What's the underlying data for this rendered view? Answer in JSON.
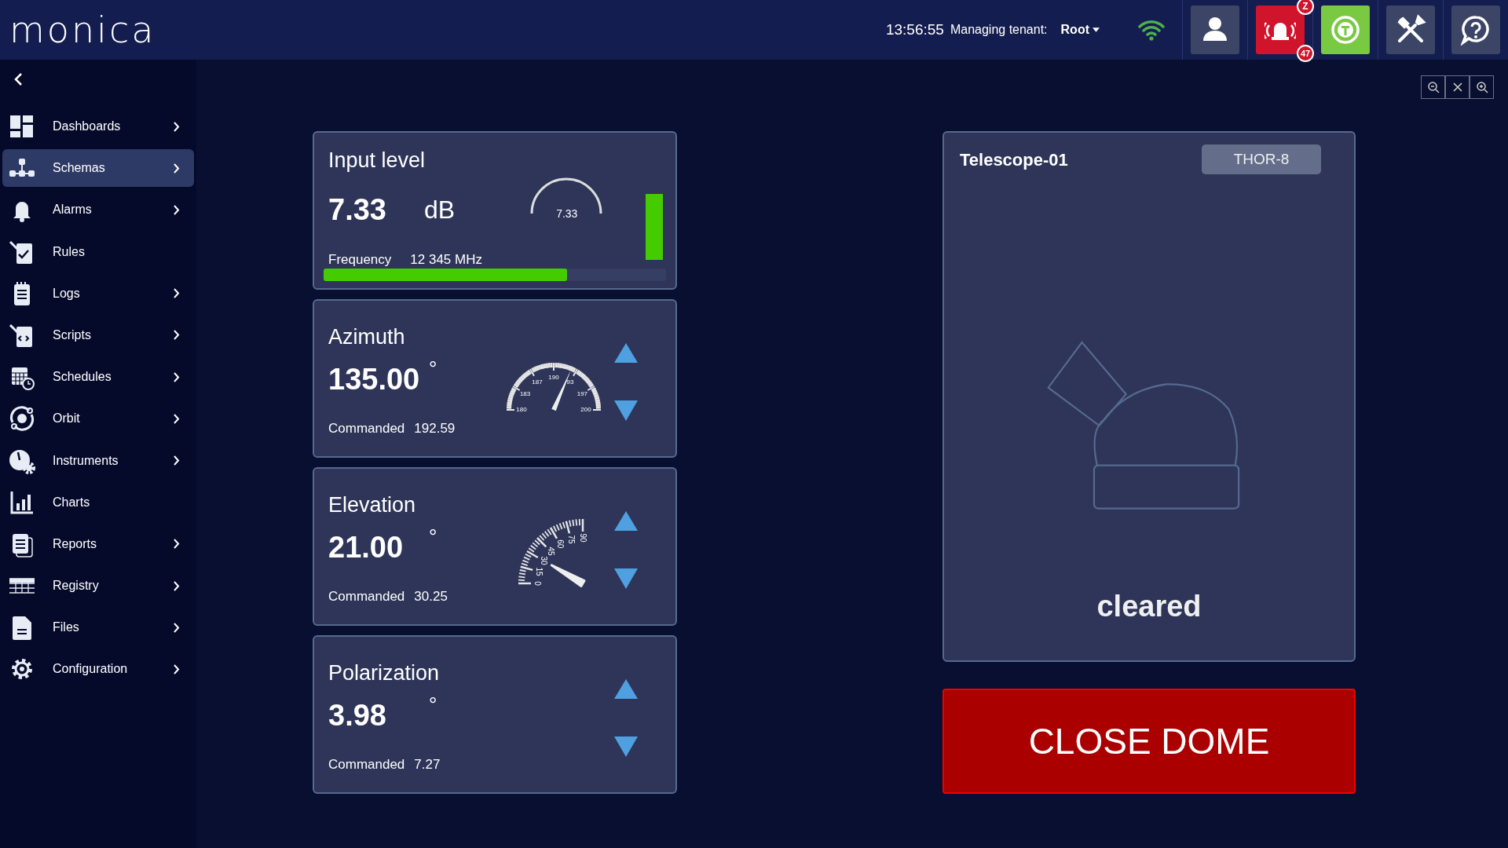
{
  "header": {
    "logo": "monica",
    "time": "13:56:55",
    "tenant_label": "Managing tenant:",
    "tenant": "Root",
    "alarm_badges": [
      {
        "text": "Z"
      },
      {
        "text": "47"
      }
    ]
  },
  "sidebar": {
    "items": [
      {
        "label": "Dashboards",
        "selected": false,
        "submenu": true
      },
      {
        "label": "Schemas",
        "selected": true,
        "submenu": true
      },
      {
        "label": "Alarms",
        "selected": false,
        "submenu": true
      },
      {
        "label": "Rules",
        "selected": false,
        "submenu": false
      },
      {
        "label": "Logs",
        "selected": false,
        "submenu": true
      },
      {
        "label": "Scripts",
        "selected": false,
        "submenu": true
      },
      {
        "label": "Schedules",
        "selected": false,
        "submenu": true
      },
      {
        "label": "Orbit",
        "selected": false,
        "submenu": true
      },
      {
        "label": "Instruments",
        "selected": false,
        "submenu": true
      },
      {
        "label": "Charts",
        "selected": false,
        "submenu": false
      },
      {
        "label": "Reports",
        "selected": false,
        "submenu": true
      },
      {
        "label": "Registry",
        "selected": false,
        "submenu": true
      },
      {
        "label": "Files",
        "selected": false,
        "submenu": true
      },
      {
        "label": "Configuration",
        "selected": false,
        "submenu": true
      }
    ]
  },
  "widgets": [
    {
      "kind": "level",
      "title": "Input level",
      "value": "7.33",
      "unit": "dB",
      "gauge_reading": "7.33",
      "frequency_label": "Frequency",
      "frequency": "12 345 MHz",
      "frequency_bar": {
        "level": 0.71
      }
    },
    {
      "kind": "dial",
      "title": "Azimuth",
      "value": "135.00",
      "unit": "°",
      "gauge": {
        "ticks": [
          "180",
          "183",
          "187",
          "190",
          "93",
          "197",
          "200"
        ]
      },
      "commanded_label": "Commanded",
      "commanded": "192.59"
    },
    {
      "kind": "quarter_dial",
      "title": "Elevation",
      "value": "21.00",
      "unit": "°",
      "gauge": {
        "ticks": [
          "0",
          "15",
          "30",
          "45",
          "60",
          "75",
          "90"
        ]
      },
      "commanded_label": "Commanded",
      "commanded": "30.25"
    },
    {
      "kind": "plain",
      "title": "Polarization",
      "value": "3.98",
      "unit": "°",
      "commanded_label": "Commanded",
      "commanded": "7.27"
    }
  ],
  "telescope": {
    "title": "Telescope-01",
    "tag": "THOR-8",
    "status": "cleared"
  },
  "action_button": "CLOSE DOME"
}
